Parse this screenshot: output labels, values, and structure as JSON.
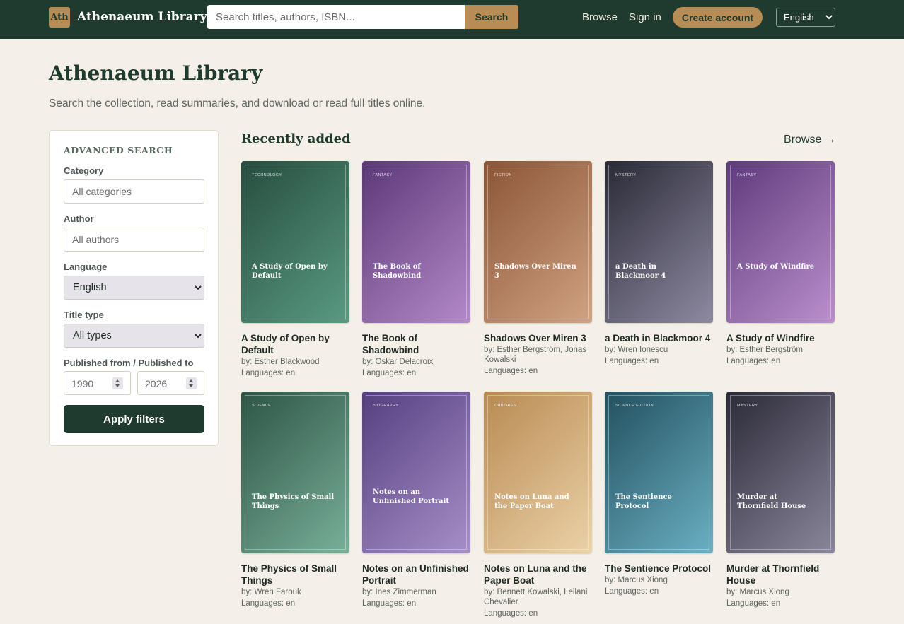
{
  "header": {
    "logo_text": "Ath",
    "brand": "Athenaeum Library",
    "search_placeholder": "Search titles, authors, ISBN...",
    "search_button": "Search",
    "nav_browse": "Browse",
    "nav_signin": "Sign in",
    "create_account": "Create account",
    "language": "English"
  },
  "hero": {
    "title": "Athenaeum Library",
    "subtitle": "Search the collection, read summaries, and download or read full titles online."
  },
  "sidebar": {
    "heading": "ADVANCED SEARCH",
    "category_label": "Category",
    "category_placeholder": "All categories",
    "author_label": "Author",
    "author_placeholder": "All authors",
    "language_label": "Language",
    "language_value": "English",
    "title_type_label": "Title type",
    "title_type_value": "All types",
    "published_label": "Published from / Published to",
    "published_from": "1990",
    "published_to": "2026",
    "apply_button": "Apply filters"
  },
  "main": {
    "section_title": "Recently added",
    "browse_link": "Browse →"
  },
  "books": [
    {
      "category": "Technology",
      "cover_title": "A Study of Open by Default",
      "title": "A Study of Open by Default",
      "authors": "by: Esther Blackwood",
      "languages": "Languages: en",
      "colors": [
        "#264d3f",
        "#5a9b82"
      ]
    },
    {
      "category": "Fantasy",
      "cover_title": "The Book of Shadowbind",
      "title": "The Book of Shadowbind",
      "authors": "by: Oskar Delacroix",
      "languages": "Languages: en",
      "colors": [
        "#5c3878",
        "#b48ac9"
      ]
    },
    {
      "category": "Fiction",
      "cover_title": "Shadows Over Miren 3",
      "title": "Shadows Over Miren 3",
      "authors": "by: Esther Bergström, Jonas Kowalski",
      "languages": "Languages: en",
      "colors": [
        "#8b5536",
        "#d0a283"
      ]
    },
    {
      "category": "Mystery",
      "cover_title": "a Death in Blackmoor 4",
      "title": "a Death in Blackmoor 4",
      "authors": "by: Wren Ionescu",
      "languages": "Languages: en",
      "colors": [
        "#2a2a36",
        "#8e8aa2"
      ]
    },
    {
      "category": "Fantasy",
      "cover_title": "A Study of Windfire",
      "title": "A Study of Windfire",
      "authors": "by: Esther Bergström",
      "languages": "Languages: en",
      "colors": [
        "#5e3a7c",
        "#bb90cc"
      ]
    },
    {
      "category": "Science",
      "cover_title": "The Physics of Small Things",
      "title": "The Physics of Small Things",
      "authors": "by: Wren Farouk",
      "languages": "Languages: en",
      "colors": [
        "#2d5545",
        "#79b09a"
      ]
    },
    {
      "category": "Biography",
      "cover_title": "Notes on an Unfinished Portrait",
      "title": "Notes on an Unfinished Portrait",
      "authors": "by: Ines Zimmerman",
      "languages": "Languages: en",
      "colors": [
        "#553f80",
        "#a790c8"
      ]
    },
    {
      "category": "Children",
      "cover_title": "Notes on Luna and the Paper Boat",
      "title": "Notes on Luna and the Paper Boat",
      "authors": "by: Bennett Kowalski, Leilani Chevalier",
      "languages": "Languages: en",
      "colors": [
        "#b88a52",
        "#ecd2a8"
      ]
    },
    {
      "category": "Science Fiction",
      "cover_title": "The Sentience Protocol",
      "title": "The Sentience Protocol",
      "authors": "by: Marcus Xiong",
      "languages": "Languages: en",
      "colors": [
        "#22505e",
        "#6bb0c4"
      ]
    },
    {
      "category": "Mystery",
      "cover_title": "Murder at Thornfield House",
      "title": "Murder at Thornfield House",
      "authors": "by: Marcus Xiong",
      "languages": "Languages: en",
      "colors": [
        "#2b2a37",
        "#8a879c"
      ]
    }
  ]
}
